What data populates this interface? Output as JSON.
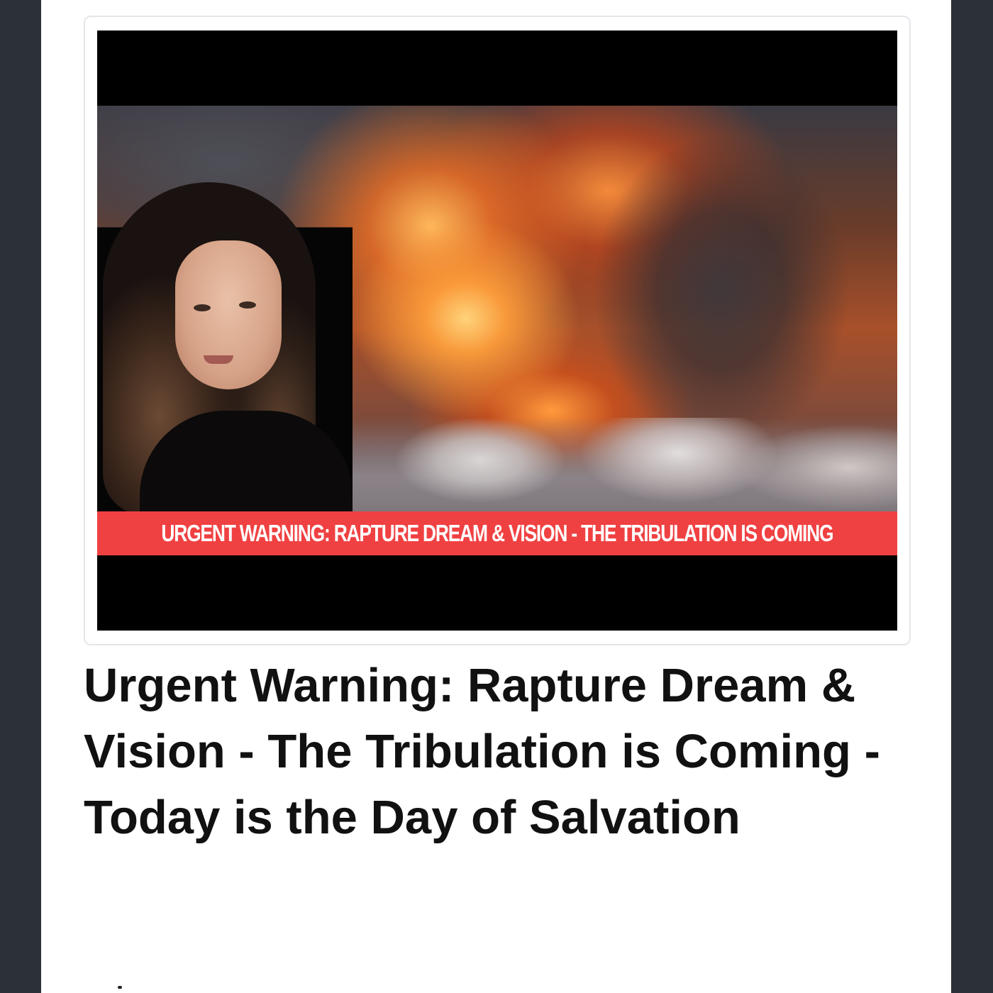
{
  "video": {
    "banner_text": "URGENT WARNING: RAPTURE DREAM & VISION - THE TRIBULATION IS COMING",
    "banner_color": "#f04142"
  },
  "post": {
    "title": "Urgent Warning: Rapture Dream & Vision - The Tribulation is Coming - Today is the Day of Salvation"
  },
  "colors": {
    "page_background": "#ffffff",
    "outer_background": "#2b3136",
    "title_text": "#111111"
  }
}
